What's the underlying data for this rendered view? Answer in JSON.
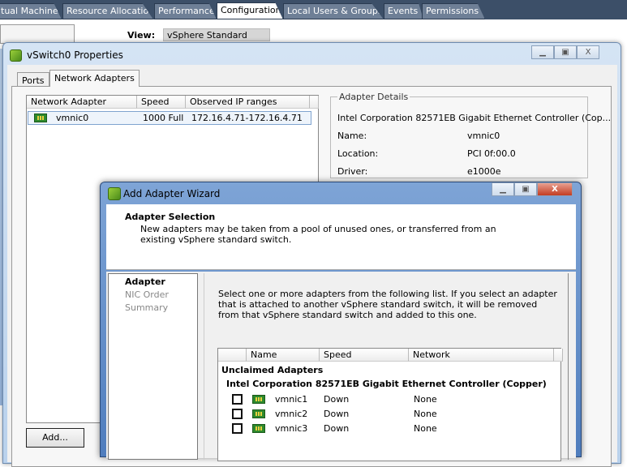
{
  "top_tabs": [
    "tual Machines",
    "Resource Allocation",
    "Performance",
    "Configuration",
    "Local Users & Groups",
    "Events",
    "Permissions"
  ],
  "active_tab": "Configuration",
  "view": {
    "label": "View:",
    "value": "vSphere Standard Switch"
  },
  "vswitch_window": {
    "title": "vSwitch0 Properties",
    "tabs": [
      "Ports",
      "Network Adapters"
    ],
    "active_tab": "Network Adapters",
    "columns": [
      "Network Adapter",
      "Speed",
      "Observed IP ranges"
    ],
    "rows": [
      {
        "adapter": "vmnic0",
        "speed": "1000 Full",
        "ip": "172.16.4.71-172.16.4.71"
      }
    ],
    "add_button": "Add...",
    "details": {
      "legend": "Adapter Details",
      "device": "Intel Corporation 82571EB Gigabit Ethernet Controller (Cop...",
      "fields": [
        {
          "label": "Name:",
          "value": "vmnic0"
        },
        {
          "label": "Location:",
          "value": "PCI 0f:00.0"
        },
        {
          "label": "Driver:",
          "value": "e1000e"
        }
      ]
    }
  },
  "wizard": {
    "title": "Add Adapter Wizard",
    "heading": "Adapter Selection",
    "subheading": "New adapters may be taken from a pool of unused ones, or transferred from an existing vSphere standard switch.",
    "steps": [
      {
        "label": "Adapter",
        "current": true
      },
      {
        "label": "NIC Order",
        "current": false
      },
      {
        "label": "Summary",
        "current": false
      }
    ],
    "instructions": "Select one or more adapters from the following list. If you select an adapter that is attached to another vSphere standard switch, it will be removed from that vSphere standard switch and added to this one.",
    "columns": [
      "",
      "Name",
      "Speed",
      "Network"
    ],
    "group": "Unclaimed Adapters",
    "subgroup": "Intel Corporation 82571EB Gigabit Ethernet Controller (Copper)",
    "adapters": [
      {
        "name": "vmnic1",
        "speed": "Down",
        "network": "None",
        "checked": false
      },
      {
        "name": "vmnic2",
        "speed": "Down",
        "network": "None",
        "checked": false
      },
      {
        "name": "vmnic3",
        "speed": "Down",
        "network": "None",
        "checked": false
      }
    ]
  }
}
